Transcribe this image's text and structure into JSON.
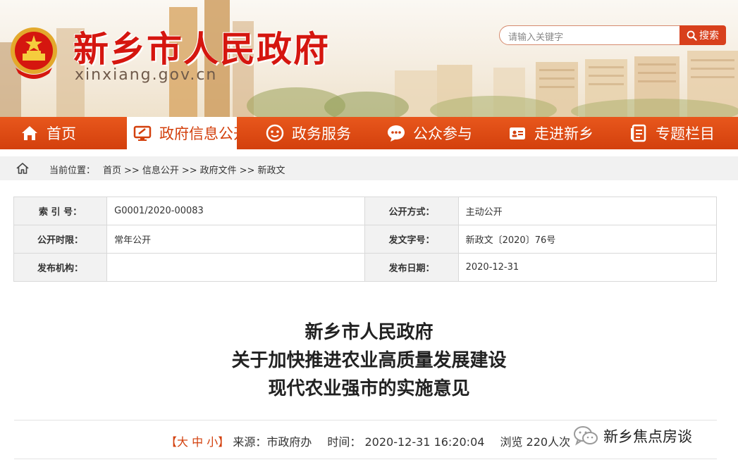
{
  "header": {
    "site_title": "新乡市人民政府",
    "site_domain": "xinxiang.gov.cn",
    "search_placeholder": "请输入关键字",
    "search_button_label": "搜索"
  },
  "nav": {
    "items": [
      {
        "label": "首页",
        "icon": "home-icon"
      },
      {
        "label": "政府信息公开",
        "icon": "monitor-icon",
        "active": true
      },
      {
        "label": "政务服务",
        "icon": "service-face-icon"
      },
      {
        "label": "公众参与",
        "icon": "chat-bubble-icon"
      },
      {
        "label": "走进新乡",
        "icon": "id-card-icon"
      },
      {
        "label": "专题栏目",
        "icon": "document-icon"
      }
    ]
  },
  "breadcrumb": {
    "label": "当前位置：",
    "items": [
      "首页",
      "信息公开",
      "政府文件",
      "新政文"
    ],
    "separator": ">>"
  },
  "meta": {
    "rows": [
      [
        {
          "key": "索 引 号：",
          "value": "G0001/2020-00083"
        },
        {
          "key": "公开方式：",
          "value": "主动公开"
        }
      ],
      [
        {
          "key": "公开时限：",
          "value": "常年公开"
        },
        {
          "key": "发文字号：",
          "value": "新政文〔2020〕76号"
        }
      ],
      [
        {
          "key": "发布机构：",
          "value": ""
        },
        {
          "key": "发布日期：",
          "value": "2020-12-31"
        }
      ]
    ]
  },
  "article": {
    "title_lines": [
      "新乡市人民政府",
      "关于加快推进农业高质量发展建设",
      "现代农业强市的实施意见"
    ]
  },
  "info": {
    "font_size_open": "【",
    "font_sizes": [
      "大",
      "中",
      "小"
    ],
    "font_size_close": "】",
    "source_label": "来源：",
    "source_value": "市政府办",
    "time_label": "时间：",
    "time_value": "2020-12-31 16:20:04",
    "views_label": "浏览",
    "views_value": "220人次"
  },
  "watermark": {
    "text": "新乡焦点房谈",
    "icon": "wechat-icon"
  },
  "colors": {
    "brand_red": "#d5160f",
    "nav_orange": "#d3400d",
    "search_button": "#d8401c"
  }
}
